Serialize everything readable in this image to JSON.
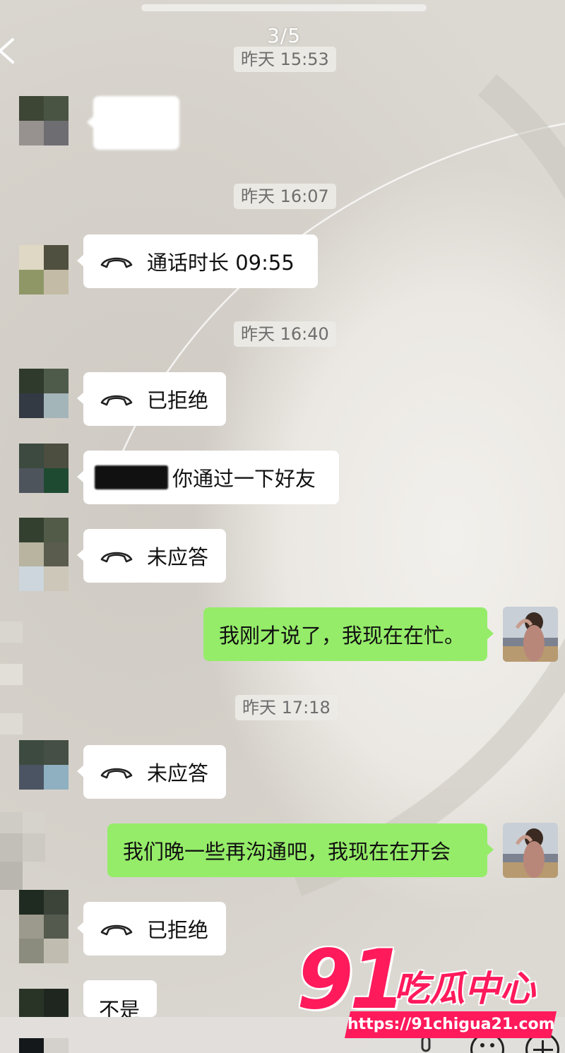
{
  "header": {
    "page_indicator": "3/5"
  },
  "messages": {
    "ts1": "昨天 15:53",
    "ts2": "昨天 16:07",
    "ts3": "昨天 16:40",
    "ts4": "昨天 17:18",
    "call1": "通话时长 09:55",
    "call2": "已拒绝",
    "text1": "你通过一下好友",
    "call3": "未应答",
    "me1": "我刚才说了，我现在在忙。",
    "call4": "未应答",
    "me2": "我们晚一些再沟通吧，我现在在开会",
    "call5": "已拒绝",
    "text2": "不是"
  },
  "watermark": {
    "number": "91",
    "title": "吃瓜中心",
    "url": "https://91chigua21.com"
  },
  "colors": {
    "sent_bubble": "#95ec69",
    "received_bubble": "#ffffff",
    "watermark": "#ff1a5c"
  },
  "icons": [
    "back-icon",
    "phone-hangup-icon",
    "voice-icon",
    "emoji-icon",
    "plus-icon"
  ]
}
